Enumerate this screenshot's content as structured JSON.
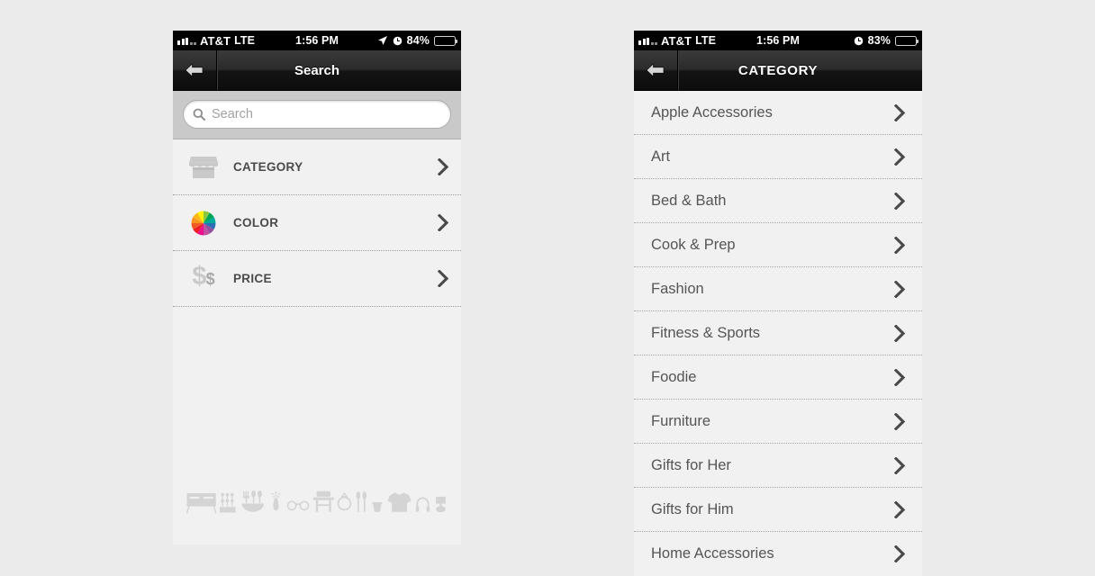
{
  "page": {
    "background_color": "#ebebeb"
  },
  "colors": {
    "nav_bar_dark": "#141414",
    "row_background": "#f1f1f1",
    "search_area_background": "#c9c9c9",
    "label_text": "#4a4a4a",
    "category_text": "#555555",
    "chevron": "#4a4a4a",
    "icon_gray": "#c9c9c9",
    "placeholder_text": "#a2a2a2"
  },
  "left_phone": {
    "status_bar": {
      "signal_icon": "signal-bars-icon",
      "carrier": "AT&T",
      "network": "LTE",
      "time": "1:56 PM",
      "location_icon": "location-arrow-icon",
      "alarm_icon": "alarm-clock-icon",
      "battery_percent": "84%",
      "battery_icon": "battery-icon"
    },
    "nav": {
      "back_icon": "back-arrow-icon",
      "title": "Search"
    },
    "search": {
      "icon": "search-icon",
      "placeholder": "Search",
      "value": ""
    },
    "filters": [
      {
        "label": "CATEGORY",
        "icon": "storefront-icon",
        "chevron": "chevron-right-icon"
      },
      {
        "label": "COLOR",
        "icon": "color-wheel-icon",
        "chevron": "chevron-right-icon"
      },
      {
        "label": "PRICE",
        "icon": "dollar-signs-icon",
        "chevron": "chevron-right-icon"
      }
    ],
    "illustration": {
      "name": "product-silhouettes-illustration",
      "items": [
        "sideboard-icon",
        "plants-icon",
        "bowl-and-utensils-icon",
        "vase-icon",
        "eyeglasses-icon",
        "chair-icon",
        "ring-icon",
        "spoons-icon",
        "cup-icon",
        "tshirt-icon",
        "headphones-icon",
        "lamp-icon"
      ]
    }
  },
  "right_phone": {
    "status_bar": {
      "signal_icon": "signal-bars-icon",
      "carrier": "AT&T",
      "network": "LTE",
      "time": "1:56 PM",
      "alarm_icon": "alarm-clock-icon",
      "battery_percent": "83%",
      "battery_icon": "battery-icon"
    },
    "nav": {
      "back_icon": "back-arrow-icon",
      "title": "CATEGORY"
    },
    "categories": [
      {
        "label": "Apple Accessories",
        "chevron": "chevron-right-icon"
      },
      {
        "label": "Art",
        "chevron": "chevron-right-icon"
      },
      {
        "label": "Bed & Bath",
        "chevron": "chevron-right-icon"
      },
      {
        "label": "Cook & Prep",
        "chevron": "chevron-right-icon"
      },
      {
        "label": "Fashion",
        "chevron": "chevron-right-icon"
      },
      {
        "label": "Fitness & Sports",
        "chevron": "chevron-right-icon"
      },
      {
        "label": "Foodie",
        "chevron": "chevron-right-icon"
      },
      {
        "label": "Furniture",
        "chevron": "chevron-right-icon"
      },
      {
        "label": "Gifts for Her",
        "chevron": "chevron-right-icon"
      },
      {
        "label": "Gifts for Him",
        "chevron": "chevron-right-icon"
      },
      {
        "label": "Home Accessories",
        "chevron": "chevron-right-icon"
      }
    ]
  }
}
